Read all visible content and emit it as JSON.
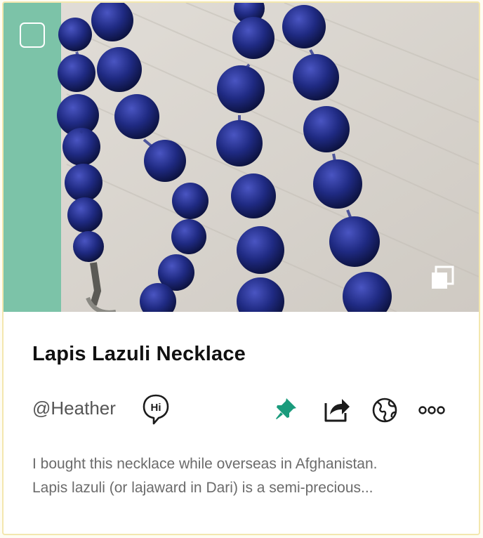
{
  "card": {
    "title": "Lapis Lazuli Necklace",
    "author": "@Heather",
    "hi_label": "Hi",
    "description_lines": [
      "I bought this necklace while overseas in Afghanistan.",
      "Lapis lazuli (or lajaward in Dari) is a semi-precious..."
    ]
  },
  "icons": {
    "select": "checkbox-icon",
    "gallery": "multiple-images-icon",
    "greet": "hi-speech-bubble-icon",
    "pin": "pin-icon",
    "share": "share-icon",
    "globe": "globe-icon",
    "more": "more-options-icon"
  },
  "colors": {
    "pin_accent": "#1a9b7c",
    "photo_teal": "#7cc3a8",
    "bead_blue": "#1f2a82",
    "border": "#f3e7ae"
  }
}
